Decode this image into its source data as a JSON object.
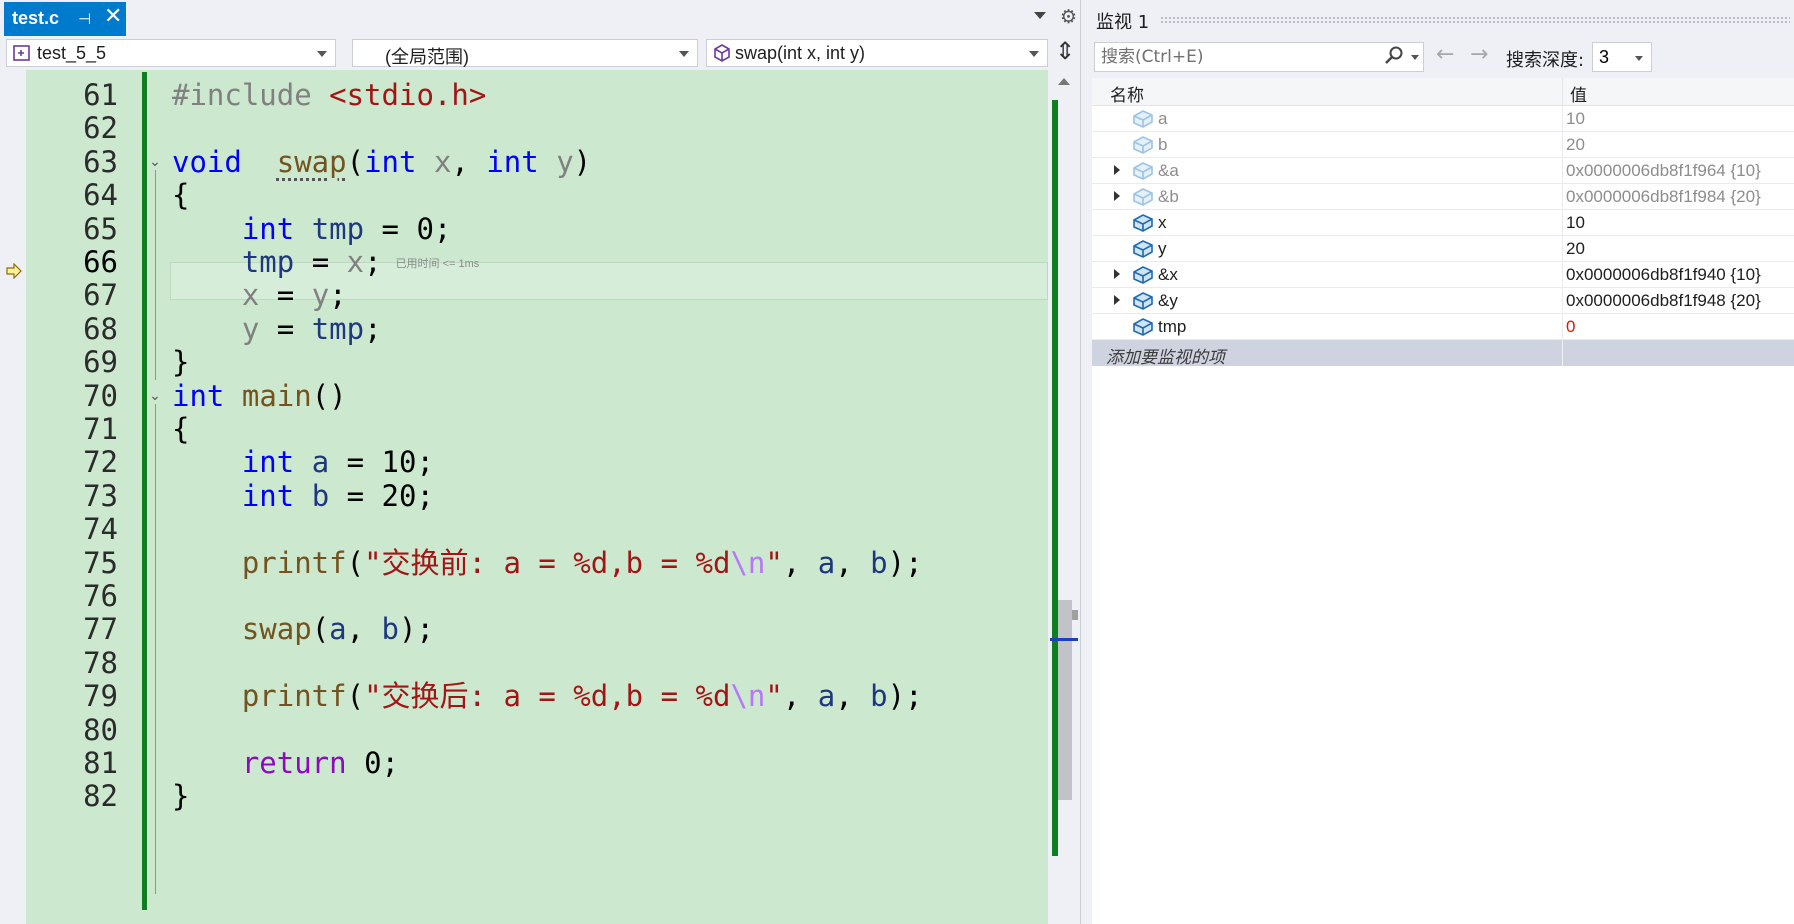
{
  "editor": {
    "tab": {
      "title": "test.c",
      "pin_glyph": "⊣",
      "close_glyph": "✕"
    },
    "nav": {
      "project": "test_5_5",
      "scope": "(全局范围)",
      "function": "swap(int x, int y)"
    },
    "lines": [
      {
        "num": "61",
        "segments": [
          [
            "inc",
            "#include "
          ],
          [
            "str",
            "<stdio.h>"
          ]
        ]
      },
      {
        "num": "62",
        "segments": []
      },
      {
        "num": "63",
        "fold": "⌄",
        "segments": [
          [
            "kw",
            "void"
          ],
          [
            "",
            "  "
          ],
          [
            "fn sq",
            "swap"
          ],
          [
            "",
            "("
          ],
          [
            "kw",
            "int"
          ],
          [
            "",
            " "
          ],
          [
            "par",
            "x"
          ],
          [
            "",
            ", "
          ],
          [
            "kw",
            "int"
          ],
          [
            "",
            " "
          ],
          [
            "par",
            "y"
          ],
          [
            "",
            ")"
          ]
        ]
      },
      {
        "num": "64",
        "segments": [
          [
            "",
            "{"
          ]
        ]
      },
      {
        "num": "65",
        "segments": [
          [
            "",
            "    "
          ],
          [
            "kw",
            "int"
          ],
          [
            "",
            " "
          ],
          [
            "loc",
            "tmp"
          ],
          [
            "",
            " = 0;"
          ]
        ]
      },
      {
        "num": "66",
        "current": true,
        "segments": [
          [
            "",
            "    "
          ],
          [
            "loc",
            "tmp"
          ],
          [
            "",
            " = "
          ],
          [
            "par",
            "x"
          ],
          [
            "",
            ";"
          ]
        ],
        "timing": "已用时间 <= 1ms"
      },
      {
        "num": "67",
        "segments": [
          [
            "",
            "    "
          ],
          [
            "par",
            "x"
          ],
          [
            "",
            " = "
          ],
          [
            "par",
            "y"
          ],
          [
            "",
            ";"
          ]
        ]
      },
      {
        "num": "68",
        "segments": [
          [
            "",
            "    "
          ],
          [
            "par",
            "y"
          ],
          [
            "",
            " = "
          ],
          [
            "loc",
            "tmp"
          ],
          [
            "",
            ";"
          ]
        ]
      },
      {
        "num": "69",
        "segments": [
          [
            "",
            "}"
          ]
        ]
      },
      {
        "num": "70",
        "fold": "⌄",
        "segments": [
          [
            "kw",
            "int"
          ],
          [
            "",
            " "
          ],
          [
            "fn",
            "main"
          ],
          [
            "",
            "()"
          ]
        ]
      },
      {
        "num": "71",
        "segments": [
          [
            "",
            "{"
          ]
        ]
      },
      {
        "num": "72",
        "segments": [
          [
            "",
            "    "
          ],
          [
            "kw",
            "int"
          ],
          [
            "",
            " "
          ],
          [
            "loc",
            "a"
          ],
          [
            "",
            " = 10;"
          ]
        ]
      },
      {
        "num": "73",
        "segments": [
          [
            "",
            "    "
          ],
          [
            "kw",
            "int"
          ],
          [
            "",
            " "
          ],
          [
            "loc",
            "b"
          ],
          [
            "",
            " = 20;"
          ]
        ]
      },
      {
        "num": "74",
        "segments": []
      },
      {
        "num": "75",
        "segments": [
          [
            "",
            "    "
          ],
          [
            "fn",
            "printf"
          ],
          [
            "",
            "("
          ],
          [
            "str",
            "\"交换前: a = %d,b = %d"
          ],
          [
            "esc",
            "\\n"
          ],
          [
            "str",
            "\""
          ],
          [
            "",
            ", "
          ],
          [
            "loc",
            "a"
          ],
          [
            "",
            ", "
          ],
          [
            "loc",
            "b"
          ],
          [
            "",
            ");"
          ]
        ]
      },
      {
        "num": "76",
        "segments": []
      },
      {
        "num": "77",
        "segments": [
          [
            "",
            "    "
          ],
          [
            "fn",
            "swap"
          ],
          [
            "",
            "("
          ],
          [
            "loc",
            "a"
          ],
          [
            "",
            ", "
          ],
          [
            "loc",
            "b"
          ],
          [
            "",
            ");"
          ]
        ]
      },
      {
        "num": "78",
        "segments": []
      },
      {
        "num": "79",
        "segments": [
          [
            "",
            "    "
          ],
          [
            "fn",
            "printf"
          ],
          [
            "",
            "("
          ],
          [
            "str",
            "\"交换后: a = %d,b = %d"
          ],
          [
            "esc",
            "\\n"
          ],
          [
            "str",
            "\""
          ],
          [
            "",
            ", "
          ],
          [
            "loc",
            "a"
          ],
          [
            "",
            ", "
          ],
          [
            "loc",
            "b"
          ],
          [
            "",
            ");"
          ]
        ]
      },
      {
        "num": "80",
        "segments": []
      },
      {
        "num": "81",
        "segments": [
          [
            "",
            "    "
          ],
          [
            "kw2",
            "return"
          ],
          [
            "",
            " 0;"
          ]
        ]
      },
      {
        "num": "82",
        "segments": [
          [
            "",
            "}"
          ]
        ]
      }
    ]
  },
  "watch": {
    "title": "监视 1",
    "search_placeholder": "搜索(Ctrl+E)",
    "depth_label": "搜索深度:",
    "depth_value": "3",
    "col_name": "名称",
    "col_value": "值",
    "rows": [
      {
        "name": "a",
        "value": "10",
        "stale": true,
        "expandable": false
      },
      {
        "name": "b",
        "value": "20",
        "stale": true,
        "expandable": false
      },
      {
        "name": "&a",
        "value": "0x0000006db8f1f964 {10}",
        "stale": true,
        "expandable": true
      },
      {
        "name": "&b",
        "value": "0x0000006db8f1f984 {20}",
        "stale": true,
        "expandable": true
      },
      {
        "name": "x",
        "value": "10",
        "stale": false,
        "expandable": false
      },
      {
        "name": "y",
        "value": "20",
        "stale": false,
        "expandable": false
      },
      {
        "name": "&x",
        "value": "0x0000006db8f1f940 {10}",
        "stale": false,
        "expandable": true
      },
      {
        "name": "&y",
        "value": "0x0000006db8f1f948 {20}",
        "stale": false,
        "expandable": true
      },
      {
        "name": "tmp",
        "value": "0",
        "stale": false,
        "expandable": false,
        "changed": true
      }
    ],
    "add_item_label": "添加要监视的项"
  },
  "colors": {
    "accent": "#007acc",
    "code_bg": "#cce8cf",
    "change_bar": "#0f7e21",
    "keyword": "#0000ff",
    "string": "#a31515",
    "changed_value": "#e51400"
  },
  "icons": {
    "tab_pin": "pin-icon",
    "tab_close": "close-icon",
    "settings": "gear-icon",
    "project": "project-icon",
    "function": "cube-icon",
    "split": "split-window-icon",
    "instruction_pointer": "execution-arrow-icon",
    "search": "search-icon",
    "back": "arrow-left-icon",
    "forward": "arrow-right-icon",
    "variable": "variable-cube-icon"
  }
}
